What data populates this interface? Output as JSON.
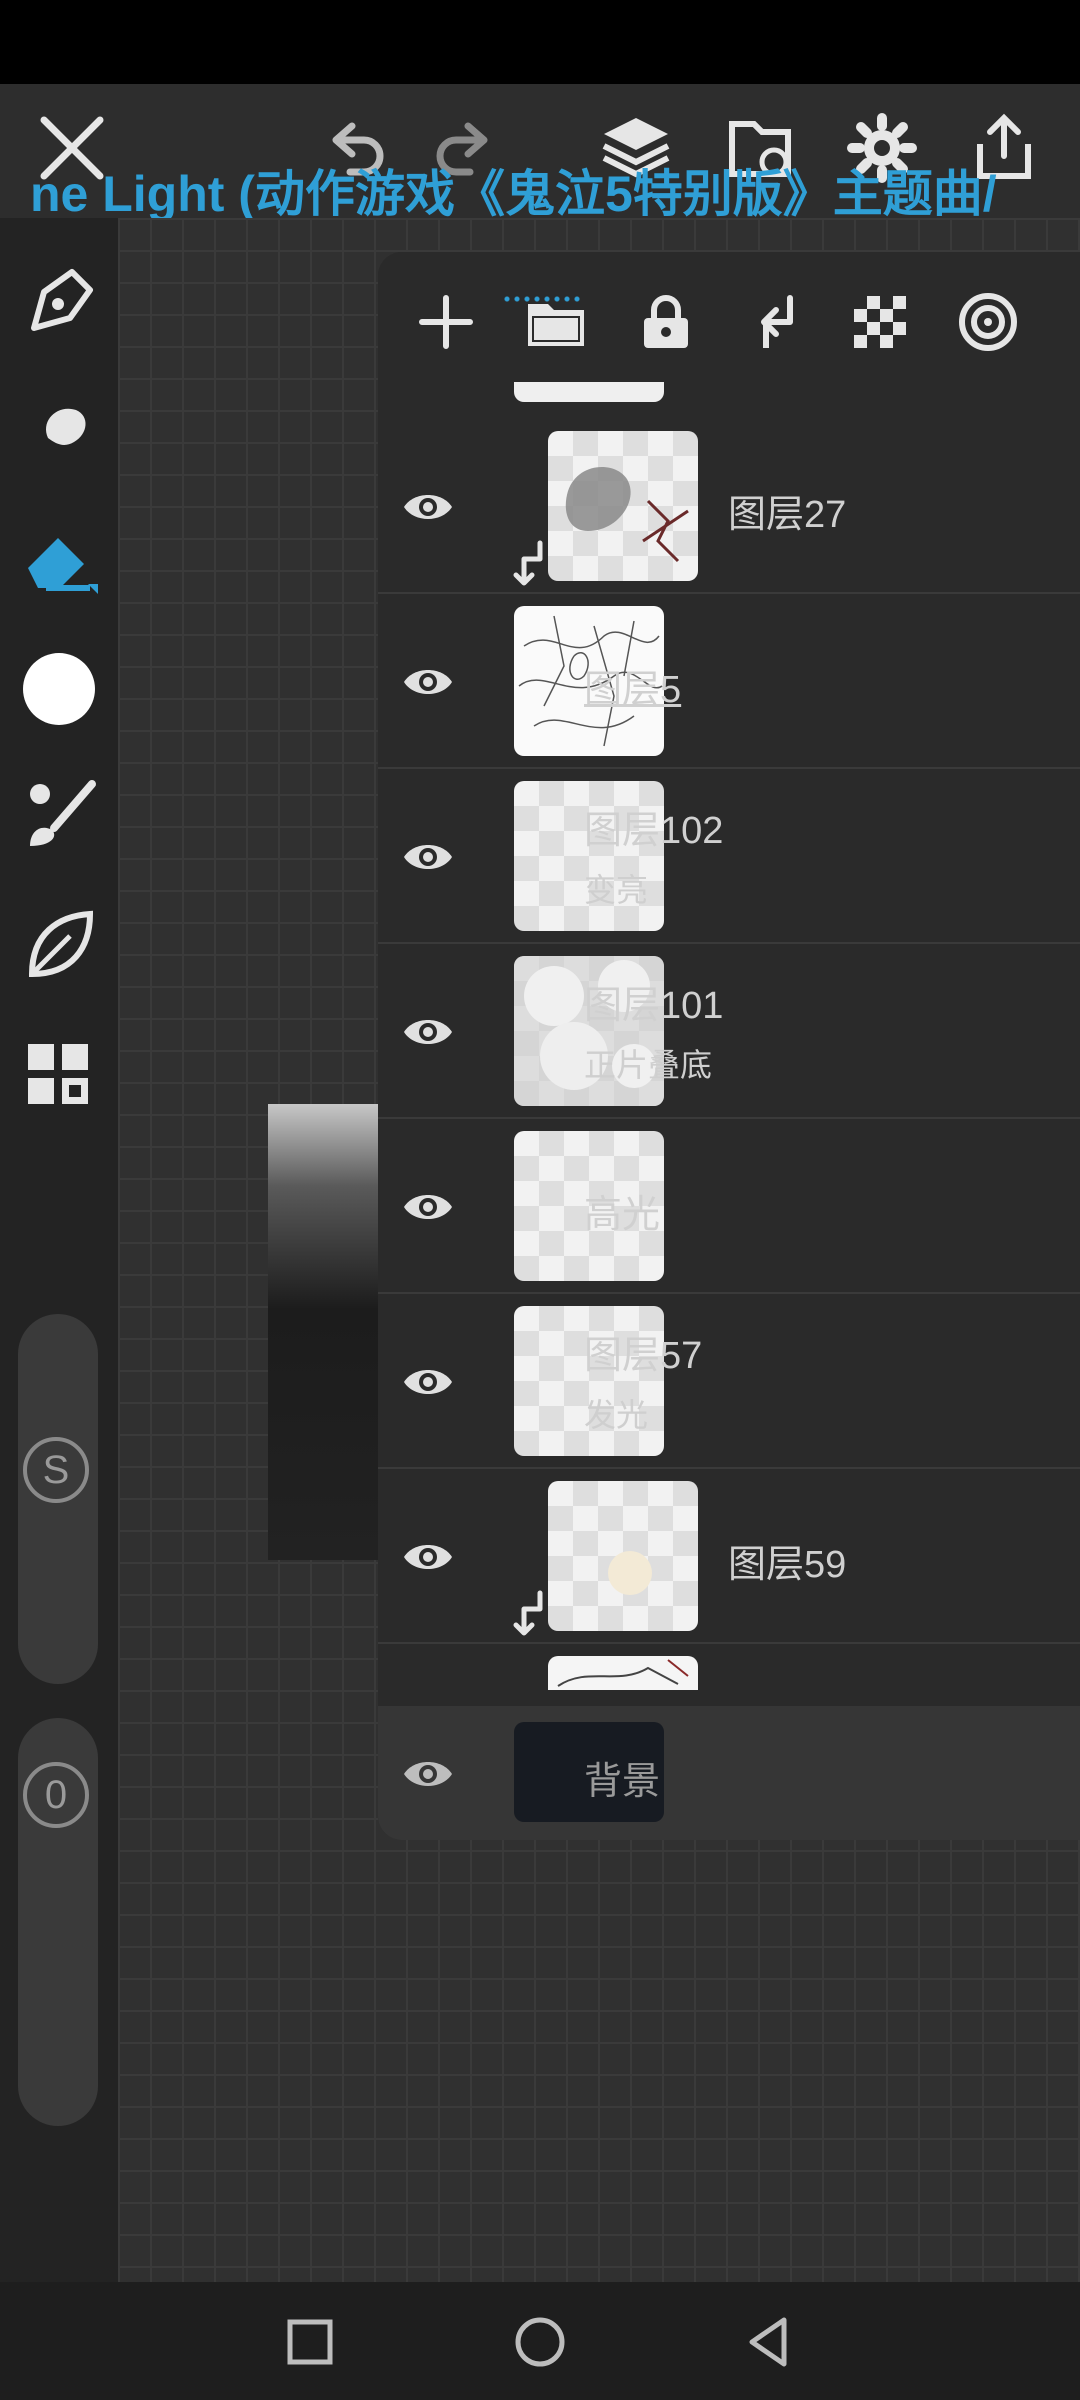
{
  "topbar": {
    "icons": [
      "close-icon",
      "undo-icon",
      "redo-icon",
      "layers-icon",
      "file-icon",
      "settings-icon",
      "share-icon"
    ]
  },
  "music": {
    "ticker_text": "ne Light (动作游戏《鬼泣5特别版》主题曲/"
  },
  "sidebar": {
    "tools": [
      "pen-icon",
      "smudge-icon",
      "eraser-icon",
      "color-swatch",
      "brush-picker-icon",
      "leaf-icon",
      "grid-icon"
    ],
    "size_label": "S",
    "opacity_label": "0"
  },
  "panel": {
    "toolbar_icons": [
      "add-layer-icon",
      "folder-icon",
      "lock-icon",
      "clip-icon",
      "transparent-icon",
      "blend-target-icon"
    ]
  },
  "layers": [
    {
      "name": "图层27",
      "mode": "",
      "clipped": true,
      "underlined": false
    },
    {
      "name": "图层5",
      "mode": "",
      "clipped": false,
      "underlined": true
    },
    {
      "name": "图层102",
      "mode": "变亮",
      "clipped": false,
      "underlined": false
    },
    {
      "name": "图层101",
      "mode": "正片叠底",
      "clipped": false,
      "underlined": false
    },
    {
      "name": "高光",
      "mode": "",
      "clipped": false,
      "underlined": false
    },
    {
      "name": "图层57",
      "mode": "发光",
      "clipped": false,
      "underlined": false
    },
    {
      "name": "图层59",
      "mode": "",
      "clipped": true,
      "underlined": false
    }
  ],
  "background_layer": {
    "name": "背景"
  },
  "colors": {
    "accent": "#2f9fd6",
    "panel": "#2a2a2a",
    "sidebar": "#232323"
  }
}
